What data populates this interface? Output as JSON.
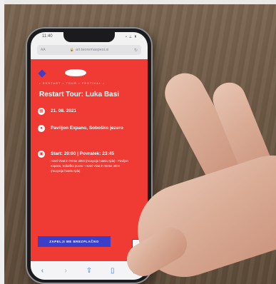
{
  "status": {
    "time": "11:40",
    "icons": "• ⟂ ▮"
  },
  "browser": {
    "url": "art.teoremaspesi.si",
    "aa": "AA",
    "lock_icon": "lock-icon",
    "reload_icon": "reload-icon"
  },
  "page": {
    "tagline": "• RESTART • TOUR • FESTIVAL •",
    "title": "Restart Tour: Luka Basi",
    "date": "21. 08. 2021",
    "location": "Paviljon Expano, Soboško jezero",
    "time": "Start: 20:00 | Povratek: 23:45",
    "route": "Hotel Vivat in Terme 3000 (recepcija hotela Ajda) - Paviljon Expano, Soboško jezero - Hotel Vivat in Terme 3000 (recepcija hotela Ajda)",
    "cta": "ZAPELJI ME BREZPLAČNO"
  },
  "icons": {
    "date": "calendar-icon",
    "location": "location-pin-icon",
    "time": "bus-icon"
  },
  "colors": {
    "page_bg": "#ef3b34",
    "accent": "#3b3ec9",
    "text": "#ffffff"
  }
}
